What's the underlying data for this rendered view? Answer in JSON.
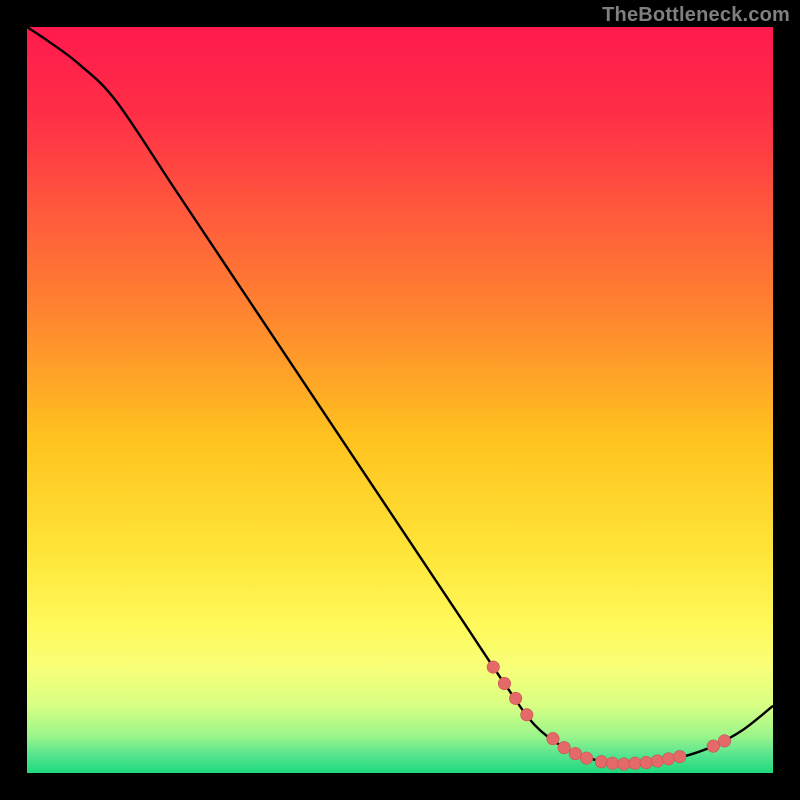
{
  "watermark": "TheBottleneck.com",
  "colors": {
    "frame": "#000000",
    "line": "#000000",
    "marker_fill": "#e46a6a",
    "marker_stroke": "#c94f4f",
    "gradient_stops": [
      {
        "offset": 0.0,
        "color": "#ff1a4d"
      },
      {
        "offset": 0.12,
        "color": "#ff2f47"
      },
      {
        "offset": 0.25,
        "color": "#ff5a3c"
      },
      {
        "offset": 0.4,
        "color": "#ff8a2e"
      },
      {
        "offset": 0.55,
        "color": "#ffc21f"
      },
      {
        "offset": 0.7,
        "color": "#ffe437"
      },
      {
        "offset": 0.8,
        "color": "#fff95a"
      },
      {
        "offset": 0.86,
        "color": "#f8ff78"
      },
      {
        "offset": 0.91,
        "color": "#d7ff84"
      },
      {
        "offset": 0.95,
        "color": "#9cf58a"
      },
      {
        "offset": 0.975,
        "color": "#58e58f"
      },
      {
        "offset": 1.0,
        "color": "#1ed97e"
      }
    ]
  },
  "chart_data": {
    "type": "line",
    "title": "",
    "xlabel": "",
    "ylabel": "",
    "xlim": [
      0,
      100
    ],
    "ylim": [
      0,
      100
    ],
    "grid": false,
    "series": [
      {
        "name": "curve",
        "x": [
          0,
          3,
          7,
          12,
          20,
          30,
          40,
          50,
          58,
          64,
          68,
          72,
          76,
          80,
          84,
          88,
          92,
          96,
          100
        ],
        "y": [
          100,
          98,
          95,
          90,
          78,
          63,
          48,
          33,
          21,
          12,
          6.5,
          3.4,
          1.8,
          1.2,
          1.4,
          2.2,
          3.6,
          5.8,
          9.0
        ]
      }
    ],
    "markers": [
      {
        "x": 62.5,
        "y": 14.2
      },
      {
        "x": 64.0,
        "y": 12.0
      },
      {
        "x": 65.5,
        "y": 10.0
      },
      {
        "x": 67.0,
        "y": 7.8
      },
      {
        "x": 70.5,
        "y": 4.6
      },
      {
        "x": 72.0,
        "y": 3.4
      },
      {
        "x": 73.5,
        "y": 2.6
      },
      {
        "x": 75.0,
        "y": 2.0
      },
      {
        "x": 77.0,
        "y": 1.5
      },
      {
        "x": 78.5,
        "y": 1.3
      },
      {
        "x": 80.0,
        "y": 1.2
      },
      {
        "x": 81.5,
        "y": 1.3
      },
      {
        "x": 83.0,
        "y": 1.4
      },
      {
        "x": 84.5,
        "y": 1.6
      },
      {
        "x": 86.0,
        "y": 1.9
      },
      {
        "x": 87.5,
        "y": 2.2
      },
      {
        "x": 92.0,
        "y": 3.6
      },
      {
        "x": 93.5,
        "y": 4.3
      }
    ]
  }
}
